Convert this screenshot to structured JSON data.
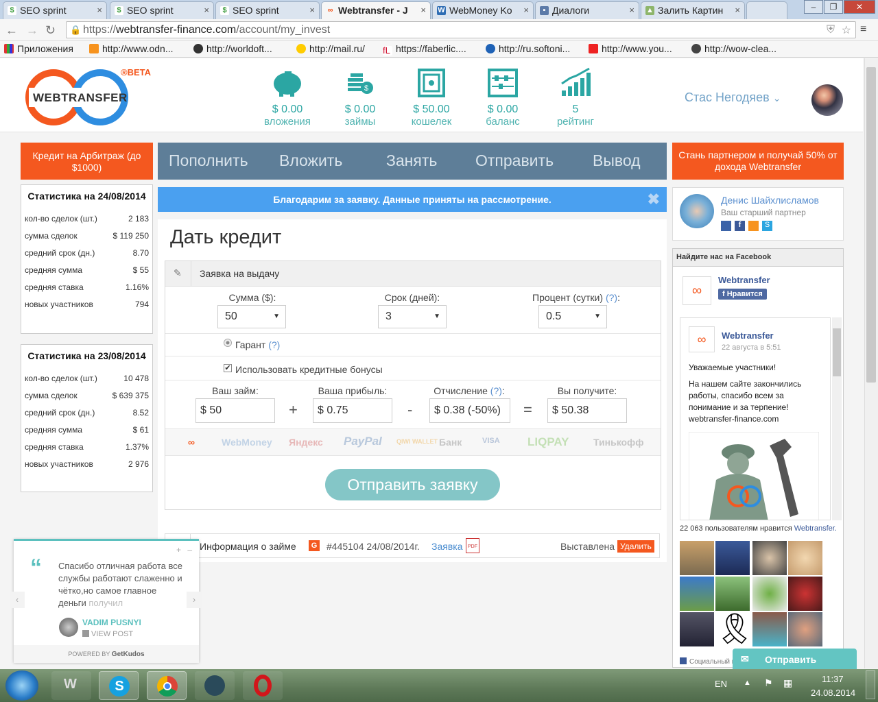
{
  "browser": {
    "tabs": [
      {
        "label": "SEO sprint",
        "active": false
      },
      {
        "label": "SEO sprint",
        "active": false
      },
      {
        "label": "SEO sprint",
        "active": false
      },
      {
        "label": "Webtransfer - J",
        "active": true
      },
      {
        "label": "WebMoney Ko",
        "active": false
      },
      {
        "label": "Диалоги",
        "active": false
      },
      {
        "label": "Залить Картин",
        "active": false
      }
    ],
    "url_scheme": "https://",
    "url_host": "webtransfer-finance.com",
    "url_path": "/account/my_invest",
    "bookmarks": [
      "Приложения",
      "http://www.odn...",
      "http://worldoft...",
      "http://mail.ru/",
      "https://faberlic....",
      "http://ru.softoni...",
      "http://www.you...",
      "http://wow-clea..."
    ]
  },
  "header": {
    "logo_text": "WEBTRANSFER",
    "beta": "®BETA",
    "stats": [
      {
        "value": "$ 0.00",
        "label": "вложения",
        "icon": "piggy-bank-icon"
      },
      {
        "value": "$ 0.00",
        "label": "займы",
        "icon": "coins-icon"
      },
      {
        "value": "$ 50.00",
        "label": "кошелек",
        "icon": "safe-icon"
      },
      {
        "value": "$ 0.00",
        "label": "баланс",
        "icon": "abacus-icon"
      },
      {
        "value": "5",
        "label": "рейтинг",
        "icon": "rating-chart-icon"
      }
    ],
    "user_name": "Стас Негодяев"
  },
  "left": {
    "credit_button": "Кредит на Арбитраж (до $1000)",
    "stat_boxes": [
      {
        "title": "Статистика на 24/08/2014",
        "rows": [
          {
            "label": "кол-во сделок (шт.)",
            "value": "2 183"
          },
          {
            "label": "сумма сделок",
            "value": "$ 119 250"
          },
          {
            "label": "средний срок (дн.)",
            "value": "8.70"
          },
          {
            "label": "средняя сумма",
            "value": "$ 55"
          },
          {
            "label": "средняя ставка",
            "value": "1.16%"
          },
          {
            "label": "новых участников",
            "value": "794"
          }
        ]
      },
      {
        "title": "Статистика на 23/08/2014",
        "rows": [
          {
            "label": "кол-во сделок (шт.)",
            "value": "10 478"
          },
          {
            "label": "сумма сделок",
            "value": "$ 639 375"
          },
          {
            "label": "средний срок (дн.)",
            "value": "8.52"
          },
          {
            "label": "средняя сумма",
            "value": "$ 61"
          },
          {
            "label": "средняя ставка",
            "value": "1.37%"
          },
          {
            "label": "новых участников",
            "value": "2 976"
          }
        ]
      }
    ]
  },
  "nav": {
    "items": [
      "Пополнить",
      "Вложить",
      "Занять",
      "Отправить",
      "Вывод"
    ]
  },
  "notice": "Благодарим за заявку. Данные приняты на рассмотрение.",
  "main": {
    "title": "Дать кредит",
    "panel_title": "Заявка на выдачу",
    "sum_label": "Сумма ($):",
    "sum_value": "50",
    "term_label": "Срок (дней):",
    "term_value": "3",
    "percent_label": "Процент (сутки)",
    "help": "(?)",
    "percent_value": "0.5",
    "guarantor": "Гарант",
    "use_bonus": "Использовать кредитные бонусы",
    "loan_label": "Ваш займ:",
    "loan_value": "$ 50",
    "profit_label": "Ваша прибыль:",
    "profit_value": "$ 0.75",
    "deduction_label": "Отчисление",
    "deduction_value": "$ 0.38 (-50%)",
    "receive_label": "Вы получите:",
    "receive_value": "$ 50.38",
    "payment_methods": [
      "WebMoney",
      "Яндекс",
      "PayPal",
      "QIWI WALLET",
      "Банк",
      "VISA",
      "LIQPAY",
      "Тинькофф"
    ],
    "submit": "Отправить заявку",
    "info_label": "Информация о займе",
    "info_number": "#445104 24/08/2014г.",
    "info_link": "Заявка",
    "info_status": "Выставлена",
    "delete": "Удалить",
    "g_badge": "G"
  },
  "right": {
    "partner_button": "Стань партнером и получай 50% от дохода Webtransfer",
    "partner_name": "Денис Шайхлисламов",
    "partner_role": "Ваш старший партнер",
    "fb_title": "Найдите нас на Facebook",
    "fb_page": "Webtransfer",
    "fb_like": "Нравится",
    "fb_post_author": "Webtransfer",
    "fb_post_date": "22 августа в 5:51",
    "fb_post_text1": "Уважаемые участники!",
    "fb_post_text2": "На нашем сайте закончились работы, спасибо всем за понимание и за терпение! webtransfer-finance.com",
    "fb_likes": "22 063 пользователям нравится ",
    "fb_likes_link": "Webtransfer.",
    "fb_social": "Социальный п",
    "send_button": "Отправить"
  },
  "kudos": {
    "quote": "Спасибо отличная работа все службы работают слаженно и чётко,но самое главное деньги ",
    "quote_faded": "получил",
    "author": "VADIM PUSNYI",
    "view": "VIEW POST",
    "powered": "POWERED BY",
    "brand": "GetKudos"
  },
  "taskbar": {
    "lang": "EN",
    "time": "11:37",
    "date": "24.08.2014"
  }
}
